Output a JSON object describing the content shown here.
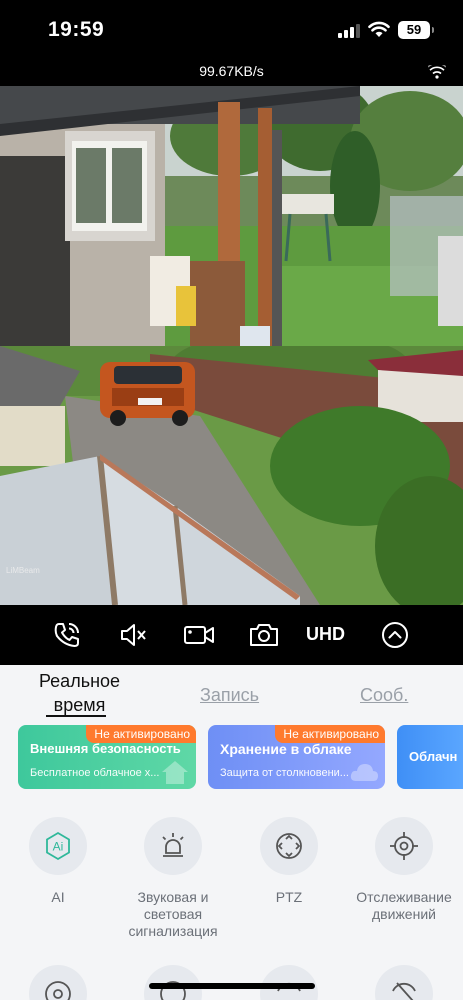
{
  "status_bar": {
    "time": "19:59",
    "battery": "59"
  },
  "stream": {
    "speed": "99.67KB/s"
  },
  "camera": {
    "watermark": "LiMBeam"
  },
  "controls": {
    "quality_label": "UHD",
    "icons": [
      "call-icon",
      "mute-icon",
      "record-icon",
      "snapshot-icon",
      "expand-icon"
    ]
  },
  "tabs": {
    "live": "Реальное время",
    "record": "Запись",
    "messages": "Сооб."
  },
  "cards": [
    {
      "badge": "Не активировано",
      "title": "Внешняя безопасность",
      "subtitle": "Бесплатное облачное х...",
      "color": "#3ec89c"
    },
    {
      "badge": "Не активировано",
      "title": "Хранение в облаке",
      "subtitle": "Защита от столкновени...",
      "color": "#6e8ff5"
    },
    {
      "title": "Облачн",
      "color": "#3f8ff6"
    }
  ],
  "features": [
    {
      "label": "AI",
      "icon": "ai-icon"
    },
    {
      "label": "Звуковая и световая сигнализация",
      "icon": "light-alarm-icon"
    },
    {
      "label": "PTZ",
      "icon": "ptz-icon"
    },
    {
      "label": "Отслеживание движений",
      "icon": "target-icon"
    }
  ]
}
